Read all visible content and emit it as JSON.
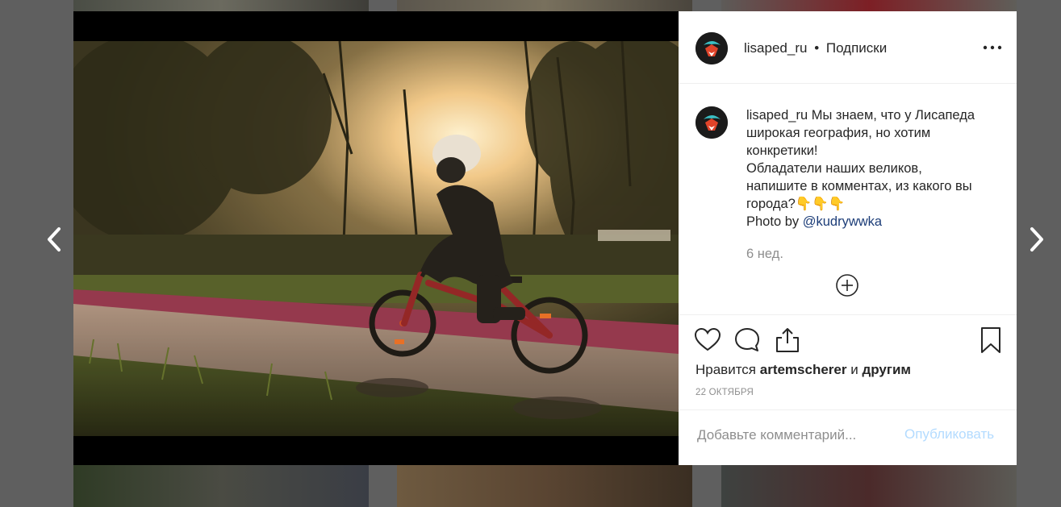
{
  "post": {
    "username": "lisaped_ru",
    "separator": "•",
    "follow_label": "Подписки",
    "caption_lines": [
      "Мы знаем, что у Лисапеда",
      "широкая география, но хотим",
      "конкретики!",
      "Обладатели наших великов,",
      "напишите в комментах, из какого вы",
      "города?👇👇👇"
    ],
    "photo_by_prefix": "Photo by ",
    "photo_by_mention": "@kudrywwka",
    "caption_time": "6 нед.",
    "likes_prefix": "Нравится ",
    "likes_user": "artemscherer",
    "likes_mid": " и ",
    "likes_suffix": "другим",
    "date": "22 ОКТЯБРЯ"
  },
  "comment": {
    "placeholder": "Добавьте комментарий...",
    "publish_label": "Опубликовать"
  },
  "icons": {
    "prev": "chevron-left-icon",
    "next": "chevron-right-icon",
    "more": "more-horizontal-icon",
    "like": "heart-icon",
    "comment": "speech-bubble-icon",
    "share": "share-icon",
    "save": "bookmark-icon",
    "load_more": "plus-circle-icon"
  },
  "colors": {
    "overlay": "#5f5f5f",
    "text": "#262626",
    "muted": "#8e8e8e",
    "mention": "#1c3d78",
    "publish_disabled": "#b3dbff",
    "avatar_teal": "#3bbfc4",
    "avatar_fox": "#e0442a"
  }
}
